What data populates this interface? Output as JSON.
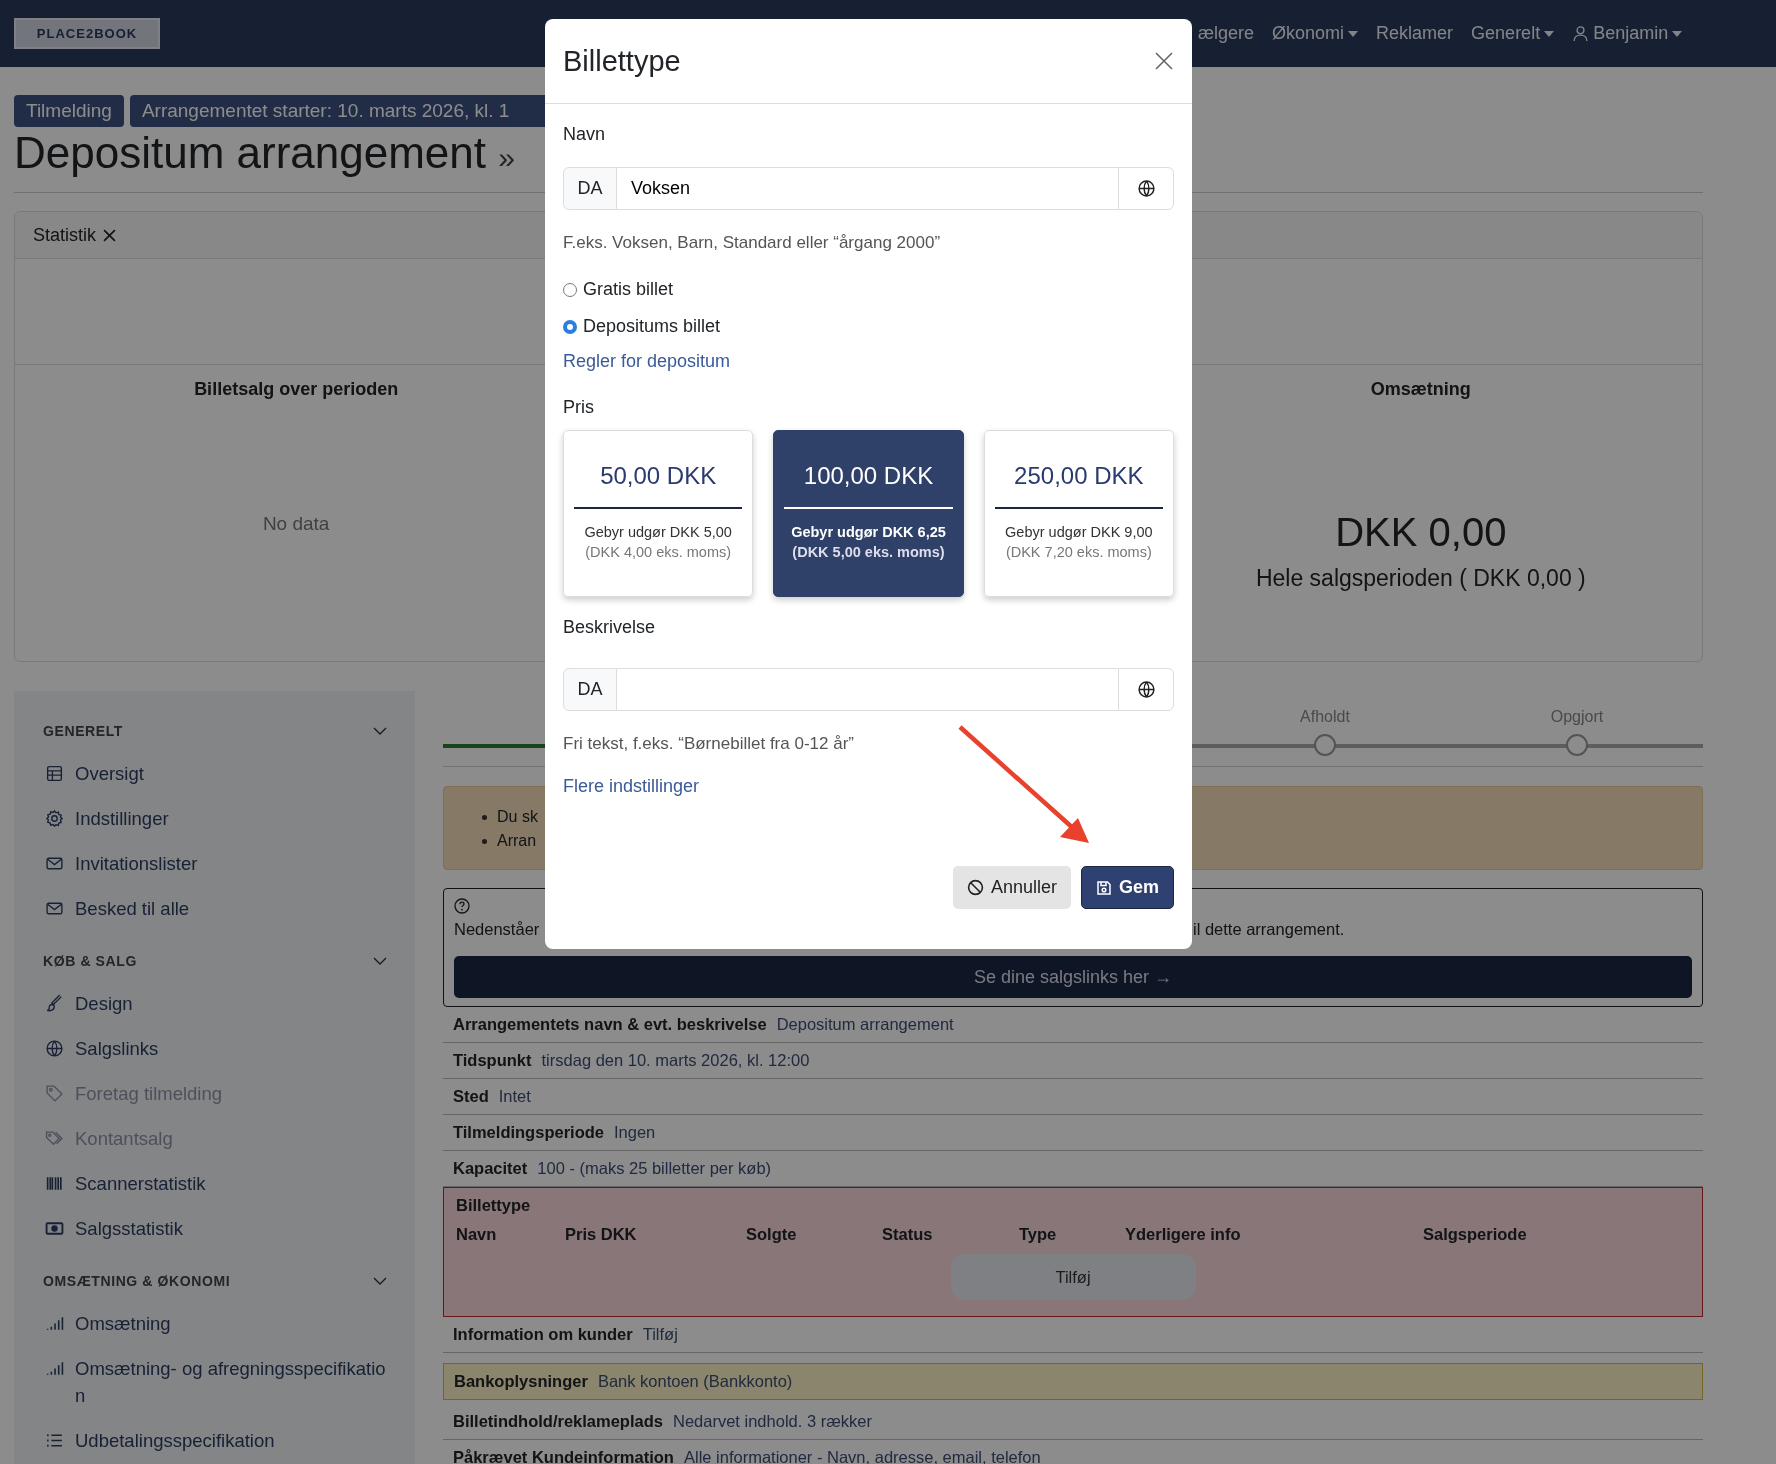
{
  "navbar": {
    "logo": "PLACE2BOOK",
    "items": [
      {
        "label": "ælgere",
        "dropdown": false,
        "kind": "link"
      },
      {
        "label": "Økonomi",
        "dropdown": true,
        "kind": "link"
      },
      {
        "label": "Reklamer",
        "dropdown": false,
        "kind": "link"
      },
      {
        "label": "Generelt",
        "dropdown": true,
        "kind": "link"
      },
      {
        "label": "Benjamin",
        "dropdown": true,
        "kind": "user"
      }
    ]
  },
  "badges": [
    "Tilmelding",
    "Arrangementet starter: 10. marts 2026, kl. 1"
  ],
  "title": "Depositum arrangement",
  "title_suffix": "»",
  "statistics": {
    "tab": "Statistik",
    "empty_panel": {
      "title": "Billetsalg over perioden",
      "message": "No data"
    },
    "revenue_panel": {
      "title": "Omsætning",
      "amount": "DKK 0,00",
      "subtitle": "Hele salgsperioden ( DKK 0,00 )"
    }
  },
  "sidebar": [
    {
      "title": "GENERELT",
      "expanded": true,
      "items": [
        {
          "label": "Oversigt",
          "disabled": false
        },
        {
          "label": "Indstillinger",
          "disabled": false
        },
        {
          "label": "Invitationslister",
          "disabled": false
        },
        {
          "label": "Besked til alle",
          "disabled": false
        }
      ]
    },
    {
      "title": "KØB & SALG",
      "expanded": true,
      "items": [
        {
          "label": "Design",
          "disabled": false
        },
        {
          "label": "Salgslinks",
          "disabled": false
        },
        {
          "label": "Foretag tilmelding",
          "disabled": true
        },
        {
          "label": "Kontantsalg",
          "disabled": true
        },
        {
          "label": "Scannerstatistik",
          "disabled": false
        },
        {
          "label": "Salgsstatistik",
          "disabled": false
        }
      ]
    },
    {
      "title": "OMSÆTNING & ØKONOMI",
      "expanded": true,
      "items": [
        {
          "label": "Omsætning",
          "disabled": false
        },
        {
          "label": "Omsætning- og afregningsspecifikation",
          "disabled": false
        },
        {
          "label": "Udbetalingsspecifikation",
          "disabled": false
        }
      ]
    }
  ],
  "stepper": {
    "steps": [
      {
        "label": "Afholdt",
        "done": false
      },
      {
        "label": "Opgjort",
        "done": false
      }
    ]
  },
  "warning": {
    "items": [
      "Du sk",
      "Arran"
    ]
  },
  "info": {
    "text_start": "Nedenståer",
    "text_end": "il dette arrangement.",
    "button": "Se dine salgslinks her →"
  },
  "details": [
    {
      "kind": "text",
      "label": "Arrangementets navn & evt. beskrivelse",
      "value": "Depositum arrangement"
    },
    {
      "kind": "text",
      "label": "Tidspunkt",
      "value": "tirsdag den 10. marts 2026, kl. 12:00"
    },
    {
      "kind": "text",
      "label": "Sted",
      "value": "Intet"
    },
    {
      "kind": "text",
      "label": "Tilmeldingsperiode",
      "value": "Ingen"
    },
    {
      "kind": "text",
      "label": "Kapacitet",
      "value": "100 - (maks 25 billetter per køb)"
    },
    {
      "kind": "tickets",
      "label": "Billettype",
      "columns": [
        "Navn",
        "Pris DKK",
        "Solgte",
        "Status",
        "Type",
        "Yderligere info",
        "Salgsperiode"
      ],
      "button": "Tilføj"
    },
    {
      "kind": "text",
      "label": "Information om kunder",
      "value": "Tilføj"
    },
    {
      "kind": "notice",
      "label": "Bankoplysninger",
      "value": "Bank kontoen (Bankkonto)"
    },
    {
      "kind": "text",
      "label": "Billetindhold/reklameplads",
      "value": "Nedarvet indhold. 3 rækker"
    },
    {
      "kind": "text",
      "label": "Påkrævet Kundeinformation",
      "value": "Alle informationer - Navn, adresse, email, telefon"
    }
  ],
  "modal": {
    "title": "Billettype",
    "name": {
      "label": "Navn",
      "lang": "DA",
      "value": "Voksen",
      "help": "F.eks. Voksen, Barn, Standard eller “årgang 2000”"
    },
    "options": [
      {
        "label": "Gratis billet",
        "selected": false
      },
      {
        "label": "Depositums billet",
        "selected": true
      }
    ],
    "rules_link": "Regler for depositum",
    "price": {
      "label": "Pris",
      "cards": [
        {
          "amount": "50,00 DKK",
          "fee": "Gebyr udgør DKK 5,00",
          "fee_excl": "(DKK 4,00 eks. moms)",
          "selected": false
        },
        {
          "amount": "100,00 DKK",
          "fee": "Gebyr udgør DKK 6,25",
          "fee_excl": "(DKK 5,00 eks. moms)",
          "selected": true
        },
        {
          "amount": "250,00 DKK",
          "fee": "Gebyr udgør DKK 9,00",
          "fee_excl": "(DKK 7,20 eks. moms)",
          "selected": false
        }
      ]
    },
    "description": {
      "label": "Beskrivelse",
      "lang": "DA",
      "help": "Fri tekst, f.eks. “Børnebillet fra 0-12 år”"
    },
    "more_link": "Flere indstillinger",
    "buttons": [
      {
        "label": "Annuller",
        "kind": "secondary"
      },
      {
        "label": "Gem",
        "kind": "primary"
      }
    ]
  }
}
